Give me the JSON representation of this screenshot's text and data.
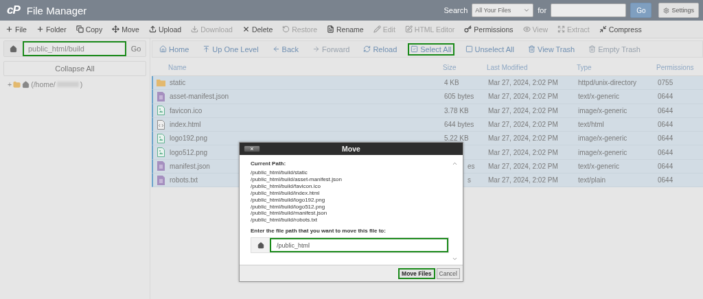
{
  "header": {
    "logo": "cP",
    "title": "File Manager",
    "search_label": "Search",
    "search_scope": "All Your Files",
    "for_label": "for",
    "go": "Go",
    "settings": "Settings"
  },
  "toolbar": [
    {
      "label": "File",
      "disabled": false
    },
    {
      "label": "Folder",
      "disabled": false
    },
    {
      "label": "Copy",
      "disabled": false
    },
    {
      "label": "Move",
      "disabled": false
    },
    {
      "label": "Upload",
      "disabled": false
    },
    {
      "label": "Download",
      "disabled": true
    },
    {
      "label": "Delete",
      "disabled": false
    },
    {
      "label": "Restore",
      "disabled": true
    },
    {
      "label": "Rename",
      "disabled": false
    },
    {
      "label": "Edit",
      "disabled": true
    },
    {
      "label": "HTML Editor",
      "disabled": true
    },
    {
      "label": "Permissions",
      "disabled": false
    },
    {
      "label": "View",
      "disabled": true
    },
    {
      "label": "Extract",
      "disabled": true
    },
    {
      "label": "Compress",
      "disabled": false
    }
  ],
  "sidebar": {
    "path_value": "public_html/build",
    "path_highlighted": true,
    "go": "Go",
    "collapse": "Collapse All",
    "tree": [
      {
        "toggle": "+",
        "label": "(/home/",
        "suffix": ")",
        "redacted": true
      }
    ]
  },
  "nav": [
    {
      "label": "Home",
      "disabled": false,
      "highlighted": false
    },
    {
      "label": "Up One Level",
      "disabled": false,
      "highlighted": false
    },
    {
      "label": "Back",
      "disabled": false,
      "highlighted": false
    },
    {
      "label": "Forward",
      "disabled": true,
      "highlighted": false
    },
    {
      "label": "Reload",
      "disabled": false,
      "highlighted": false
    },
    {
      "label": "Select All",
      "disabled": false,
      "highlighted": true
    },
    {
      "label": "Unselect All",
      "disabled": false,
      "highlighted": false
    },
    {
      "label": "View Trash",
      "disabled": false,
      "highlighted": false
    },
    {
      "label": "Empty Trash",
      "disabled": true,
      "highlighted": false
    }
  ],
  "table": {
    "columns": [
      "Name",
      "Size",
      "Last Modified",
      "Type",
      "Permissions"
    ],
    "rows": [
      {
        "kind": "folder",
        "name": "static",
        "size": "4 KB",
        "modified": "Mar 27, 2024, 2:02 PM",
        "type": "httpd/unix-directory",
        "permissions": "0755",
        "selected": true
      },
      {
        "kind": "text",
        "name": "asset-manifest.json",
        "size": "605 bytes",
        "modified": "Mar 27, 2024, 2:02 PM",
        "type": "text/x-generic",
        "permissions": "0644",
        "selected": true
      },
      {
        "kind": "image",
        "name": "favicon.ico",
        "size": "3.78 KB",
        "modified": "Mar 27, 2024, 2:02 PM",
        "type": "image/x-generic",
        "permissions": "0644",
        "selected": true
      },
      {
        "kind": "code",
        "name": "index.html",
        "size": "644 bytes",
        "modified": "Mar 27, 2024, 2:02 PM",
        "type": "text/html",
        "permissions": "0644",
        "selected": true
      },
      {
        "kind": "image",
        "name": "logo192.png",
        "size": "5.22 KB",
        "modified": "Mar 27, 2024, 2:02 PM",
        "type": "image/x-generic",
        "permissions": "0644",
        "selected": true
      },
      {
        "kind": "image",
        "name": "logo512.png",
        "modified": "Mar 27, 2024, 2:02 PM",
        "type": "image/x-generic",
        "permissions": "0644",
        "selected": true
      },
      {
        "kind": "text",
        "name": "manifest.json",
        "size": "es",
        "size_cut": true,
        "modified": "Mar 27, 2024, 2:02 PM",
        "type": "text/x-generic",
        "permissions": "0644",
        "selected": true
      },
      {
        "kind": "text",
        "name": "robots.txt",
        "size": "s",
        "size_cut": true,
        "modified": "Mar 27, 2024, 2:02 PM",
        "type": "text/plain",
        "permissions": "0644",
        "selected": true
      }
    ]
  },
  "dialog": {
    "close": "×",
    "title": "Move",
    "current_label": "Current Path:",
    "paths": [
      "/public_html/build/static",
      "/public_html/build/asset-manifest.json",
      "/public_html/build/favicon.ico",
      "/public_html/build/index.html",
      "/public_html/build/logo192.png",
      "/public_html/build/logo512.png",
      "/public_html/build/manifest.json",
      "/public_html/build/robots.txt"
    ],
    "prompt": "Enter the file path that you want to move this file to:",
    "target_value": "/public_html",
    "target_highlighted": true,
    "buttons": [
      {
        "label": "Move Files",
        "kind": "primary",
        "highlighted": true
      },
      {
        "label": "Cancel",
        "kind": "secondary",
        "highlighted": false
      }
    ]
  }
}
